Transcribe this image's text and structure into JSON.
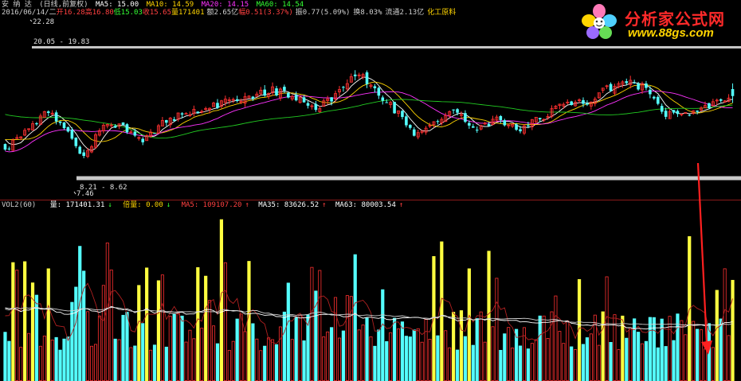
{
  "header": {
    "stock_name": "安 纳 达",
    "period": "(日线,前复权)",
    "ma": [
      {
        "label": "MA5: 15.00",
        "color": "#ffffff"
      },
      {
        "label": "MA10: 14.59",
        "color": "#ffd400"
      },
      {
        "label": "MA20: 14.15",
        "color": "#ff33ff"
      },
      {
        "label": "MA60: 14.54",
        "color": "#33ff33"
      }
    ],
    "info": [
      {
        "label": "2016/06/14/二",
        "color": "#cfcfcf"
      },
      {
        "label": "开16.28",
        "color": "#ff4040"
      },
      {
        "label": "高16.80",
        "color": "#ff4040"
      },
      {
        "label": "低15.03",
        "color": "#33ff33"
      },
      {
        "label": "收15.65",
        "color": "#ff4040"
      },
      {
        "label": "量171401",
        "color": "#ffd400"
      },
      {
        "label": "额2.65亿",
        "color": "#cfcfcf"
      },
      {
        "label": "幅0.51(3.37%)",
        "color": "#ff4040"
      },
      {
        "label": "振0.77(5.09%)",
        "color": "#cfcfcf"
      },
      {
        "label": "换8.03%",
        "color": "#cfcfcf"
      },
      {
        "label": "流通2.13亿",
        "color": "#cfcfcf"
      },
      {
        "label": "化工原料",
        "color": "#ffd400"
      }
    ]
  },
  "price_labels": {
    "high": "22.28",
    "upper_range": "20.05 - 19.83",
    "lower_range": "8.21 - 8.62",
    "low": "7.46"
  },
  "volume_header": [
    {
      "label": "VOL2(60)",
      "color": "#cfcfcf"
    },
    {
      "label": "量: 171401.31",
      "color": "#ffffff"
    },
    {
      "label": "倍量: 0.00",
      "color": "#ffd400"
    },
    {
      "label": "MA5: 109107.20",
      "color": "#ff4040"
    },
    {
      "label": "MA35: 83626.52",
      "color": "#ffffff"
    },
    {
      "label": "MA63: 80003.54",
      "color": "#ffffff"
    }
  ],
  "logo": {
    "title": "分析家公式网",
    "url": "www.88gs.com"
  },
  "colors": {
    "up": "#ff3030",
    "down": "#54ffff",
    "double_volume": "#ffff40",
    "ma5": "#ffffff",
    "ma10": "#ffd400",
    "ma20": "#ff33ff",
    "ma60": "#22cc22",
    "band": "#c8c8c8",
    "arrow": "#ff2020"
  },
  "chart_data": {
    "type": "candlestick",
    "price_range": [
      7.46,
      22.28
    ],
    "channel_upper": 20.05,
    "channel_lower": 8.21,
    "last_bar": {
      "date": "2016/06/14",
      "open": 16.28,
      "high": 16.8,
      "low": 15.03,
      "close": 15.65,
      "volume": 171401
    },
    "moving_averages": {
      "MA5": 15.0,
      "MA10": 14.59,
      "MA20": 14.15,
      "MA60": 14.54
    },
    "volume_indicator": {
      "name": "VOL2(60)",
      "volume": 171401.31,
      "double_volume": 0.0,
      "MA5": 109107.2,
      "MA35": 83626.52,
      "MA63": 80003.54
    }
  }
}
